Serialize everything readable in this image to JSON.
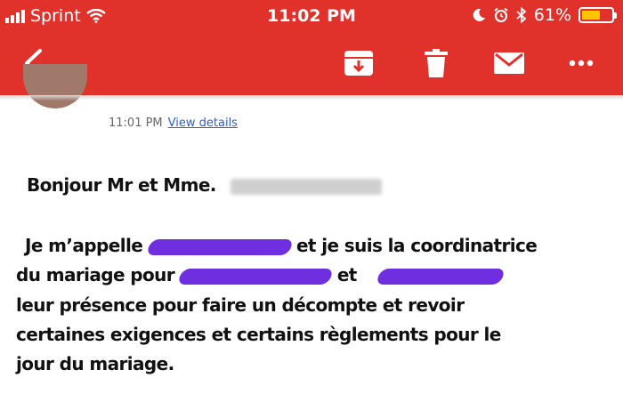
{
  "status_bar": {
    "carrier": "Sprint",
    "time": "11:02 PM",
    "battery": "61%",
    "battery_level": 0.61,
    "battery_color": "#ffc400"
  },
  "toolbar": {
    "back_icon": "chevron-left-icon",
    "archive_icon": "archive-icon",
    "delete_icon": "trash-icon",
    "mark_unread_icon": "mail-icon",
    "more_icon": "more-horizontal-icon",
    "background_color": "#e0322b"
  },
  "email": {
    "sent_time": "11:01 PM",
    "view_details": "View details",
    "greeting": "Bonjour Mr et Mme.",
    "line1_start": "Je m’appelle",
    "line1_end": "et je suis la coordinatrice",
    "line2_start": "du mariage pour",
    "line2_mid": "et",
    "line3": "leur présence pour faire un décompte et revoir",
    "line4": "certaines exigences et certains règlements pour le",
    "line5": "jour du mariage."
  }
}
